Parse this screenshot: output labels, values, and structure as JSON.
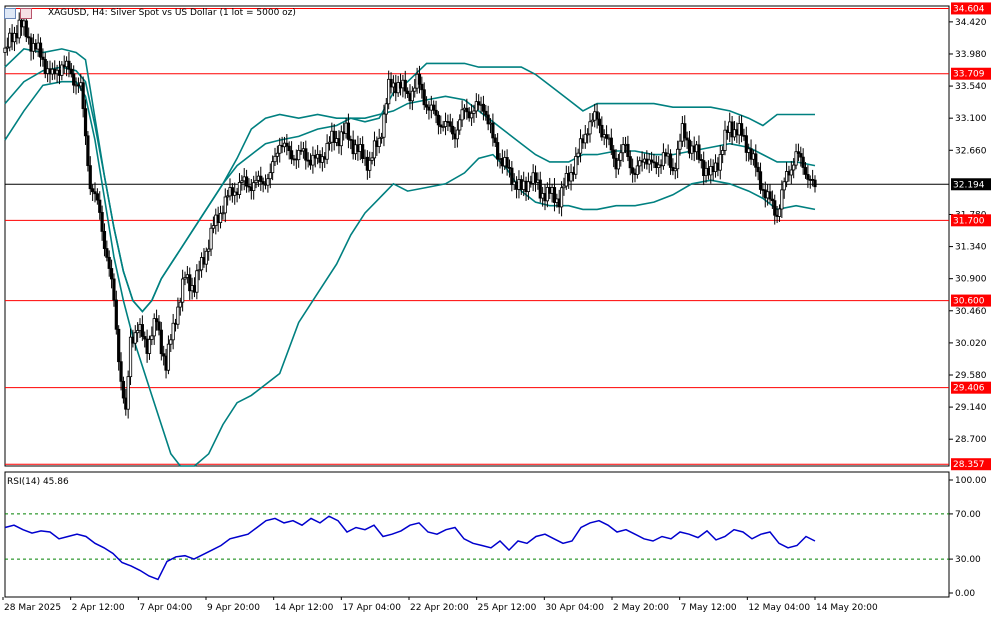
{
  "header": {
    "title": "XAGUSD, H4:  Silver Spot vs US Dollar (1 lot = 5000 oz)"
  },
  "rsi_panel": {
    "title": "RSI(14) 45.86"
  },
  "colors": {
    "candle": "#000000",
    "bollinger": "#008080",
    "level_line": "#ff0000",
    "current_price_line": "#000000",
    "rsi_line": "#0000cd",
    "rsi_levels": "#008000",
    "level_badge_bg": "#ff0000",
    "price_badge_bg": "#000000"
  },
  "chart_data": [
    {
      "type": "candlestick",
      "title": "XAGUSD, H4:  Silver Spot vs US Dollar (1 lot = 5000 oz)",
      "x_labels": [
        "28 Mar 2025",
        "2 Apr 12:00",
        "7 Apr 04:00",
        "9 Apr 20:00",
        "14 Apr 12:00",
        "17 Apr 04:00",
        "22 Apr 20:00",
        "25 Apr 12:00",
        "30 Apr 04:00",
        "2 May 20:00",
        "7 May 12:00",
        "12 May 04:00",
        "14 May 20:00"
      ],
      "y_ticks": [
        28.7,
        29.14,
        29.58,
        30.02,
        30.46,
        30.9,
        31.34,
        31.78,
        32.66,
        33.1,
        33.54,
        33.98,
        34.42
      ],
      "ylim": [
        28.36,
        34.61
      ],
      "horizontal_levels": [
        {
          "value": 34.604,
          "label": "34.604"
        },
        {
          "value": 33.709,
          "label": "33.709"
        },
        {
          "value": 31.7,
          "label": "31.700"
        },
        {
          "value": 30.6,
          "label": "30.600"
        },
        {
          "value": 29.406,
          "label": "29.406"
        },
        {
          "value": 28.357,
          "label": "28.357"
        }
      ],
      "current_price": {
        "value": 32.194,
        "label": "32.194"
      },
      "indicators": [
        "Bollinger Bands (upper, middle, lower)"
      ],
      "close_path": [
        {
          "x": 0,
          "y": 34.0
        },
        {
          "x": 6,
          "y": 34.4
        },
        {
          "x": 10,
          "y": 34.2
        },
        {
          "x": 16,
          "y": 33.9
        },
        {
          "x": 20,
          "y": 33.65
        },
        {
          "x": 24,
          "y": 33.85
        },
        {
          "x": 28,
          "y": 33.7
        },
        {
          "x": 32,
          "y": 33.5
        },
        {
          "x": 36,
          "y": 32.2
        },
        {
          "x": 40,
          "y": 31.8
        },
        {
          "x": 43,
          "y": 31.2
        },
        {
          "x": 46,
          "y": 30.6
        },
        {
          "x": 49,
          "y": 29.5
        },
        {
          "x": 51,
          "y": 29.0
        },
        {
          "x": 53,
          "y": 30.1
        },
        {
          "x": 56,
          "y": 30.2
        },
        {
          "x": 60,
          "y": 30.0
        },
        {
          "x": 64,
          "y": 30.3
        },
        {
          "x": 68,
          "y": 29.7
        },
        {
          "x": 72,
          "y": 30.4
        },
        {
          "x": 76,
          "y": 30.9
        },
        {
          "x": 80,
          "y": 30.8
        },
        {
          "x": 84,
          "y": 31.2
        },
        {
          "x": 88,
          "y": 31.6
        },
        {
          "x": 92,
          "y": 31.9
        },
        {
          "x": 96,
          "y": 32.1
        },
        {
          "x": 100,
          "y": 32.2
        },
        {
          "x": 106,
          "y": 32.2
        },
        {
          "x": 112,
          "y": 32.3
        },
        {
          "x": 116,
          "y": 32.8
        },
        {
          "x": 120,
          "y": 32.6
        },
        {
          "x": 126,
          "y": 32.6
        },
        {
          "x": 132,
          "y": 32.5
        },
        {
          "x": 138,
          "y": 32.8
        },
        {
          "x": 144,
          "y": 32.9
        },
        {
          "x": 150,
          "y": 32.6
        },
        {
          "x": 154,
          "y": 32.5
        },
        {
          "x": 158,
          "y": 32.8
        },
        {
          "x": 162,
          "y": 33.5
        },
        {
          "x": 166,
          "y": 33.6
        },
        {
          "x": 170,
          "y": 33.4
        },
        {
          "x": 174,
          "y": 33.6
        },
        {
          "x": 178,
          "y": 33.3
        },
        {
          "x": 182,
          "y": 33.1
        },
        {
          "x": 186,
          "y": 33.0
        },
        {
          "x": 190,
          "y": 32.9
        },
        {
          "x": 194,
          "y": 33.2
        },
        {
          "x": 198,
          "y": 33.2
        },
        {
          "x": 202,
          "y": 33.3
        },
        {
          "x": 206,
          "y": 32.8
        },
        {
          "x": 210,
          "y": 32.5
        },
        {
          "x": 214,
          "y": 32.3
        },
        {
          "x": 218,
          "y": 32.1
        },
        {
          "x": 222,
          "y": 32.3
        },
        {
          "x": 226,
          "y": 32.1
        },
        {
          "x": 230,
          "y": 32.05
        },
        {
          "x": 234,
          "y": 32.0
        },
        {
          "x": 238,
          "y": 32.3
        },
        {
          "x": 242,
          "y": 32.6
        },
        {
          "x": 246,
          "y": 33.0
        },
        {
          "x": 250,
          "y": 33.1
        },
        {
          "x": 254,
          "y": 32.8
        },
        {
          "x": 258,
          "y": 32.5
        },
        {
          "x": 262,
          "y": 32.7
        },
        {
          "x": 266,
          "y": 32.3
        },
        {
          "x": 270,
          "y": 32.6
        },
        {
          "x": 274,
          "y": 32.4
        },
        {
          "x": 278,
          "y": 32.6
        },
        {
          "x": 282,
          "y": 32.4
        },
        {
          "x": 286,
          "y": 32.9
        },
        {
          "x": 290,
          "y": 32.7
        },
        {
          "x": 294,
          "y": 32.5
        },
        {
          "x": 298,
          "y": 32.3
        },
        {
          "x": 302,
          "y": 32.6
        },
        {
          "x": 306,
          "y": 33.0
        },
        {
          "x": 310,
          "y": 32.9
        },
        {
          "x": 314,
          "y": 32.7
        },
        {
          "x": 318,
          "y": 32.3
        },
        {
          "x": 322,
          "y": 32.0
        },
        {
          "x": 326,
          "y": 31.8
        },
        {
          "x": 330,
          "y": 32.3
        },
        {
          "x": 334,
          "y": 32.6
        },
        {
          "x": 338,
          "y": 32.4
        },
        {
          "x": 342,
          "y": 32.1
        }
      ],
      "bollinger": {
        "upper": [
          {
            "x": 0,
            "y": 33.8
          },
          {
            "x": 8,
            "y": 34.05
          },
          {
            "x": 16,
            "y": 34.0
          },
          {
            "x": 24,
            "y": 34.05
          },
          {
            "x": 30,
            "y": 34.0
          },
          {
            "x": 34,
            "y": 33.9
          },
          {
            "x": 38,
            "y": 33.1
          },
          {
            "x": 42,
            "y": 32.3
          },
          {
            "x": 46,
            "y": 31.6
          },
          {
            "x": 50,
            "y": 31.0
          },
          {
            "x": 54,
            "y": 30.6
          },
          {
            "x": 58,
            "y": 30.45
          },
          {
            "x": 62,
            "y": 30.6
          },
          {
            "x": 66,
            "y": 30.9
          },
          {
            "x": 70,
            "y": 31.1
          },
          {
            "x": 74,
            "y": 31.3
          },
          {
            "x": 80,
            "y": 31.6
          },
          {
            "x": 86,
            "y": 31.9
          },
          {
            "x": 92,
            "y": 32.2
          },
          {
            "x": 98,
            "y": 32.55
          },
          {
            "x": 104,
            "y": 32.95
          },
          {
            "x": 110,
            "y": 33.1
          },
          {
            "x": 116,
            "y": 33.15
          },
          {
            "x": 124,
            "y": 33.1
          },
          {
            "x": 132,
            "y": 33.15
          },
          {
            "x": 140,
            "y": 33.1
          },
          {
            "x": 146,
            "y": 33.1
          },
          {
            "x": 152,
            "y": 33.05
          },
          {
            "x": 158,
            "y": 33.1
          },
          {
            "x": 164,
            "y": 33.45
          },
          {
            "x": 170,
            "y": 33.6
          },
          {
            "x": 178,
            "y": 33.85
          },
          {
            "x": 186,
            "y": 33.85
          },
          {
            "x": 194,
            "y": 33.85
          },
          {
            "x": 200,
            "y": 33.8
          },
          {
            "x": 206,
            "y": 33.8
          },
          {
            "x": 212,
            "y": 33.8
          },
          {
            "x": 218,
            "y": 33.8
          },
          {
            "x": 224,
            "y": 33.7
          },
          {
            "x": 230,
            "y": 33.55
          },
          {
            "x": 238,
            "y": 33.35
          },
          {
            "x": 244,
            "y": 33.2
          },
          {
            "x": 250,
            "y": 33.3
          },
          {
            "x": 258,
            "y": 33.3
          },
          {
            "x": 266,
            "y": 33.3
          },
          {
            "x": 274,
            "y": 33.3
          },
          {
            "x": 282,
            "y": 33.25
          },
          {
            "x": 290,
            "y": 33.25
          },
          {
            "x": 298,
            "y": 33.25
          },
          {
            "x": 306,
            "y": 33.2
          },
          {
            "x": 314,
            "y": 33.1
          },
          {
            "x": 320,
            "y": 33.0
          },
          {
            "x": 326,
            "y": 33.15
          },
          {
            "x": 334,
            "y": 33.15
          },
          {
            "x": 342,
            "y": 33.15
          }
        ],
        "middle": [
          {
            "x": 0,
            "y": 33.3
          },
          {
            "x": 8,
            "y": 33.6
          },
          {
            "x": 16,
            "y": 33.75
          },
          {
            "x": 24,
            "y": 33.8
          },
          {
            "x": 30,
            "y": 33.75
          },
          {
            "x": 34,
            "y": 33.6
          },
          {
            "x": 38,
            "y": 33.0
          },
          {
            "x": 42,
            "y": 32.3
          },
          {
            "x": 46,
            "y": 31.6
          },
          {
            "x": 50,
            "y": 31.0
          },
          {
            "x": 54,
            "y": 30.6
          },
          {
            "x": 58,
            "y": 30.45
          },
          {
            "x": 62,
            "y": 30.6
          },
          {
            "x": 66,
            "y": 30.9
          },
          {
            "x": 70,
            "y": 31.1
          },
          {
            "x": 74,
            "y": 31.3
          },
          {
            "x": 80,
            "y": 31.6
          },
          {
            "x": 86,
            "y": 31.9
          },
          {
            "x": 92,
            "y": 32.2
          },
          {
            "x": 98,
            "y": 32.45
          },
          {
            "x": 104,
            "y": 32.6
          },
          {
            "x": 110,
            "y": 32.75
          },
          {
            "x": 116,
            "y": 32.8
          },
          {
            "x": 124,
            "y": 32.85
          },
          {
            "x": 132,
            "y": 32.95
          },
          {
            "x": 140,
            "y": 33.0
          },
          {
            "x": 146,
            "y": 33.1
          },
          {
            "x": 152,
            "y": 33.1
          },
          {
            "x": 158,
            "y": 33.15
          },
          {
            "x": 164,
            "y": 33.2
          },
          {
            "x": 170,
            "y": 33.3
          },
          {
            "x": 178,
            "y": 33.35
          },
          {
            "x": 186,
            "y": 33.4
          },
          {
            "x": 194,
            "y": 33.35
          },
          {
            "x": 200,
            "y": 33.2
          },
          {
            "x": 206,
            "y": 33.05
          },
          {
            "x": 212,
            "y": 32.9
          },
          {
            "x": 218,
            "y": 32.75
          },
          {
            "x": 224,
            "y": 32.6
          },
          {
            "x": 230,
            "y": 32.5
          },
          {
            "x": 238,
            "y": 32.5
          },
          {
            "x": 244,
            "y": 32.6
          },
          {
            "x": 250,
            "y": 32.6
          },
          {
            "x": 258,
            "y": 32.65
          },
          {
            "x": 266,
            "y": 32.65
          },
          {
            "x": 274,
            "y": 32.6
          },
          {
            "x": 282,
            "y": 32.6
          },
          {
            "x": 290,
            "y": 32.65
          },
          {
            "x": 298,
            "y": 32.7
          },
          {
            "x": 306,
            "y": 32.75
          },
          {
            "x": 314,
            "y": 32.7
          },
          {
            "x": 320,
            "y": 32.6
          },
          {
            "x": 326,
            "y": 32.5
          },
          {
            "x": 334,
            "y": 32.5
          },
          {
            "x": 342,
            "y": 32.45
          }
        ],
        "lower": [
          {
            "x": 0,
            "y": 32.8
          },
          {
            "x": 8,
            "y": 33.2
          },
          {
            "x": 16,
            "y": 33.55
          },
          {
            "x": 24,
            "y": 33.6
          },
          {
            "x": 30,
            "y": 33.6
          },
          {
            "x": 34,
            "y": 33.4
          },
          {
            "x": 38,
            "y": 32.8
          },
          {
            "x": 42,
            "y": 32.0
          },
          {
            "x": 46,
            "y": 31.2
          },
          {
            "x": 50,
            "y": 30.6
          },
          {
            "x": 54,
            "y": 30.1
          },
          {
            "x": 58,
            "y": 29.7
          },
          {
            "x": 62,
            "y": 29.3
          },
          {
            "x": 66,
            "y": 28.9
          },
          {
            "x": 70,
            "y": 28.5
          },
          {
            "x": 74,
            "y": 28.3
          },
          {
            "x": 80,
            "y": 28.3
          },
          {
            "x": 86,
            "y": 28.5
          },
          {
            "x": 92,
            "y": 28.9
          },
          {
            "x": 98,
            "y": 29.2
          },
          {
            "x": 104,
            "y": 29.3
          },
          {
            "x": 110,
            "y": 29.45
          },
          {
            "x": 116,
            "y": 29.6
          },
          {
            "x": 124,
            "y": 30.3
          },
          {
            "x": 132,
            "y": 30.7
          },
          {
            "x": 140,
            "y": 31.1
          },
          {
            "x": 146,
            "y": 31.5
          },
          {
            "x": 152,
            "y": 31.8
          },
          {
            "x": 158,
            "y": 32.0
          },
          {
            "x": 164,
            "y": 32.2
          },
          {
            "x": 170,
            "y": 32.1
          },
          {
            "x": 178,
            "y": 32.15
          },
          {
            "x": 186,
            "y": 32.2
          },
          {
            "x": 194,
            "y": 32.35
          },
          {
            "x": 200,
            "y": 32.55
          },
          {
            "x": 206,
            "y": 32.6
          },
          {
            "x": 212,
            "y": 32.4
          },
          {
            "x": 218,
            "y": 32.1
          },
          {
            "x": 224,
            "y": 31.95
          },
          {
            "x": 230,
            "y": 31.9
          },
          {
            "x": 238,
            "y": 31.9
          },
          {
            "x": 244,
            "y": 31.85
          },
          {
            "x": 250,
            "y": 31.85
          },
          {
            "x": 258,
            "y": 31.9
          },
          {
            "x": 266,
            "y": 31.9
          },
          {
            "x": 274,
            "y": 31.95
          },
          {
            "x": 282,
            "y": 32.05
          },
          {
            "x": 290,
            "y": 32.2
          },
          {
            "x": 298,
            "y": 32.25
          },
          {
            "x": 306,
            "y": 32.2
          },
          {
            "x": 314,
            "y": 32.1
          },
          {
            "x": 320,
            "y": 32.0
          },
          {
            "x": 326,
            "y": 31.85
          },
          {
            "x": 334,
            "y": 31.9
          },
          {
            "x": 342,
            "y": 31.85
          }
        ]
      }
    },
    {
      "type": "line",
      "title": "RSI(14) 45.86",
      "y_ticks": [
        0.0,
        30.0,
        70.0,
        100.0
      ],
      "ylim": [
        0,
        100
      ],
      "levels": [
        30,
        70
      ],
      "values": [
        58,
        60,
        56,
        53,
        55,
        54,
        48,
        50,
        52,
        50,
        44,
        40,
        35,
        27,
        24,
        20,
        15,
        12,
        28,
        32,
        33,
        30,
        34,
        38,
        42,
        48,
        50,
        52,
        58,
        64,
        66,
        62,
        64,
        60,
        66,
        62,
        68,
        64,
        54,
        58,
        56,
        60,
        50,
        52,
        55,
        60,
        62,
        54,
        52,
        56,
        58,
        48,
        44,
        42,
        40,
        46,
        38,
        46,
        44,
        50,
        52,
        48,
        44,
        46,
        58,
        62,
        64,
        60,
        54,
        56,
        52,
        48,
        46,
        50,
        48,
        54,
        52,
        49,
        55,
        47,
        50,
        56,
        54,
        48,
        52,
        54,
        44,
        40,
        42,
        50,
        46
      ],
      "last_value": 45.86
    }
  ]
}
